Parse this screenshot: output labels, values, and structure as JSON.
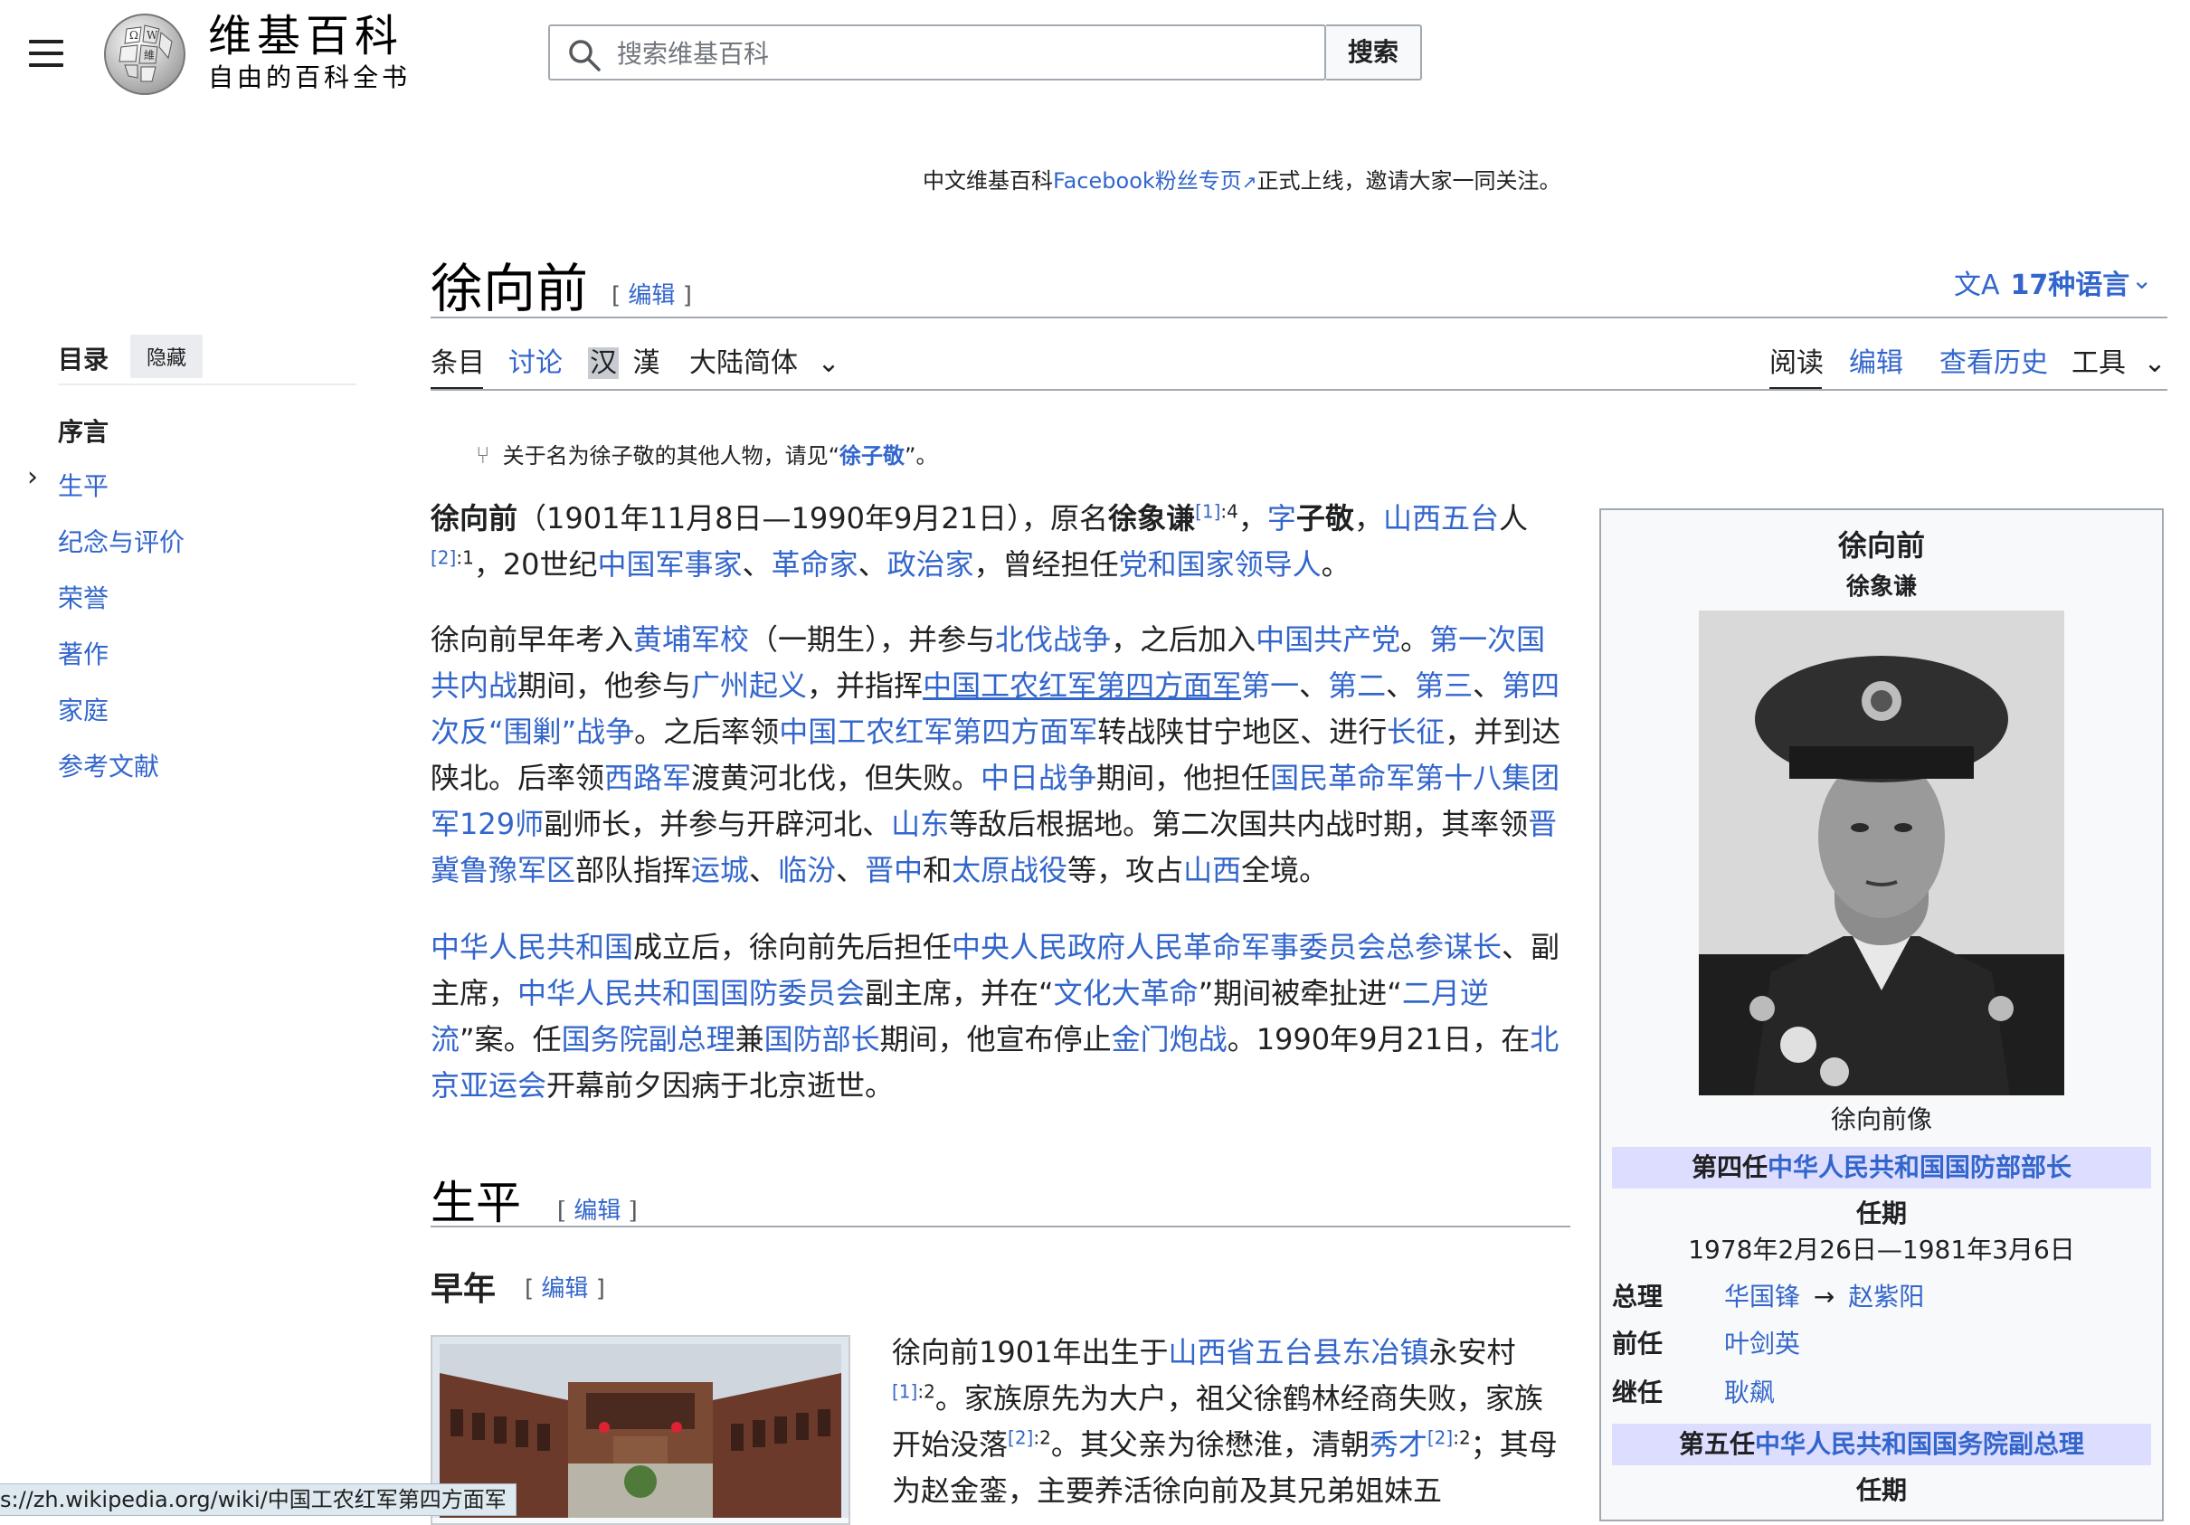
{
  "header": {
    "menu_icon": "hamburger-icon",
    "logo_icon": "wikipedia-globe-icon",
    "wordmark_title": "维基百科",
    "wordmark_tagline": "自由的百科全书",
    "search_placeholder": "搜索维基百科",
    "search_button": "搜索"
  },
  "sitenotice": {
    "before": "中文维基百科",
    "link": "Facebook粉丝专页",
    "after": "正式上线，邀请大家一同关注。"
  },
  "toc": {
    "title": "目录",
    "hide": "隐藏",
    "items": [
      "序言",
      "生平",
      "纪念与评价",
      "荣誉",
      "著作",
      "家庭",
      "参考文献"
    ]
  },
  "article": {
    "title": "徐向前",
    "edit": "编辑",
    "languages": "17种语言",
    "tabs_left": [
      "条目",
      "讨论"
    ],
    "variant_hans": "汉",
    "variant_hant": "漢",
    "variant_select": "大陆简体",
    "tabs_right": [
      "阅读",
      "编辑",
      "查看历史",
      "工具"
    ],
    "hatnote_before": "关于名为徐子敬的其他人物，请见“",
    "hatnote_link": "徐子敬",
    "hatnote_after": "”。",
    "h2_life": "生平",
    "h3_early": "早年"
  },
  "paragraphs": {
    "p1": [
      "徐向前",
      "（1901年11月8日—1990年9月21日），原名",
      "徐象谦",
      "[1]",
      ":4",
      "，",
      "字",
      "子敬",
      "，",
      "山西五台",
      "人",
      "[2]",
      ":1",
      "，20世纪",
      "中国军事家",
      "、",
      "革命家",
      "、",
      "政治家",
      "，曾经担任",
      "党和国家领导人",
      "。"
    ],
    "p2": [
      "徐向前早年考入",
      "黄埔军校",
      "（一期生），并参与",
      "北伐战争",
      "，之后加入",
      "中国共产党",
      "。",
      "第一次国共内战",
      "期间，他参与",
      "广州起义",
      "，并指挥",
      "中国工农红军第四方面军",
      "第一",
      "、",
      "第二",
      "、",
      "第三",
      "、",
      "第四次反“围剿”战争",
      "。之后率领",
      "中国工农红军第四方面军",
      "转战陕甘宁地区、进行",
      "长征",
      "，并到达陕北。后率领",
      "西路军",
      "渡黄河北伐，但失败。",
      "中日战争",
      "期间，他担任",
      "国民革命军第十八集团军",
      "129师",
      "副师长，并参与开辟河北、",
      "山东",
      "等敌后根据地。第二次国共内战时期，其率领",
      "晋冀鲁豫军区",
      "部队指挥",
      "运城",
      "、",
      "临汾",
      "、",
      "晋中",
      "和",
      "太原战役",
      "等，攻占",
      "山西",
      "全境。"
    ],
    "p3": [
      "中华人民共和国",
      "成立后，徐向前先后担任",
      "中央人民政府人民革命军事委员会总参谋长",
      "、副主席，",
      "中华人民共和国国防委员会",
      "副主席，并在“",
      "文化大革命",
      "”期间被牵扯进“",
      "二月逆流",
      "”案。任",
      "国务院副总理",
      "兼",
      "国防部长",
      "期间，他宣布停止",
      "金门炮战",
      "。1990年9月21日，在",
      "北京亚运会",
      "开幕前夕因病于北京逝世。"
    ],
    "p4": [
      "徐向前1901年出生于",
      "山西省五台县东冶镇",
      "永安村",
      "[1]",
      ":2",
      "。家族原先为大户，祖父徐鹤林经商失败，家族开始没落",
      "[2]",
      ":2",
      "。其父亲为徐懋淮，清朝",
      "秀才",
      "[2]",
      ":2",
      "；其母为赵金銮，主要养活徐向前及其兄弟姐妹五"
    ]
  },
  "infobox": {
    "title": "徐向前",
    "subtitle": "徐象谦",
    "caption": "徐向前像",
    "band1_prefix": "第四任",
    "band1_link": "中华人民共和国国防部部长",
    "term_label": "任期",
    "term1": "1978年2月26日—1981年3月6日",
    "premier_label": "总理",
    "premier_1": "华国锋",
    "premier_arrow": "→",
    "premier_2": "赵紫阳",
    "pred_label": "前任",
    "pred": "叶剑英",
    "succ_label": "继任",
    "succ": "耿飙",
    "band2_prefix": "第五任",
    "band2_link": "中华人民共和国国务院副总理",
    "term2_label": "任期"
  },
  "statusbar": {
    "url": "s://zh.wikipedia.org/wiki/中国工农红军第四方面军"
  },
  "colors": {
    "link": "#3366cc",
    "text": "#202122",
    "infobox_band": "#ddddff",
    "infobox_bg": "#f8f9fa"
  }
}
